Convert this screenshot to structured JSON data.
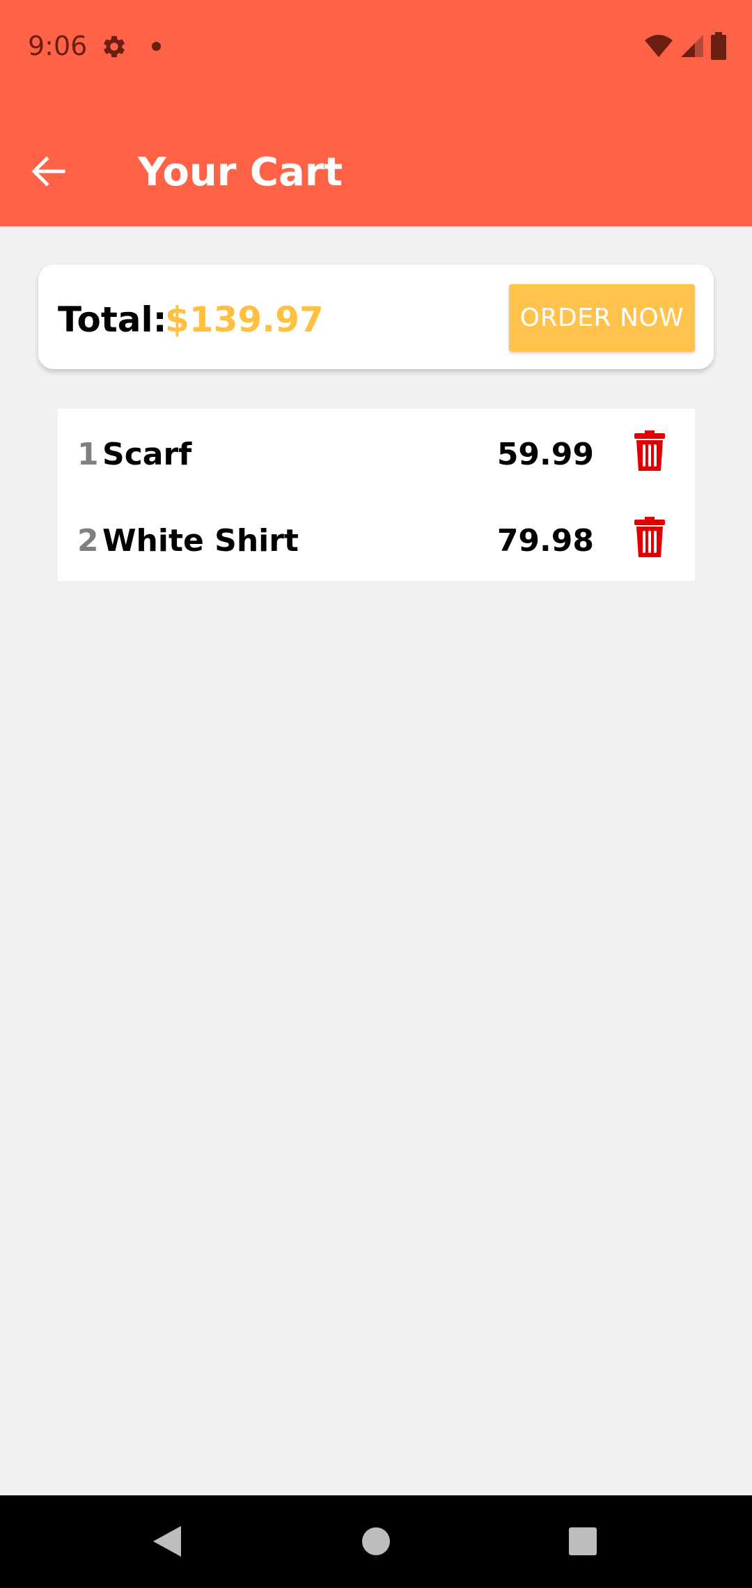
{
  "status_bar": {
    "time": "9:06",
    "icons": [
      "gear-icon",
      "notification-dot-icon",
      "wifi-icon",
      "cell-signal-icon",
      "battery-icon"
    ]
  },
  "app_bar": {
    "title": "Your Cart",
    "back_icon": "arrow-left-icon",
    "background_color": "#ff6347"
  },
  "summary": {
    "total_label": "Total:",
    "total_amount": "$139.97",
    "amount_color": "#ffbf40",
    "order_button_label": "ORDER NOW",
    "order_button_color": "#ffc24d"
  },
  "cart": {
    "items": [
      {
        "index": "1",
        "name": "Scarf",
        "price": "59.99",
        "delete_icon": "trash-icon"
      },
      {
        "index": "2",
        "name": "White Shirt",
        "price": "79.98",
        "delete_icon": "trash-icon"
      }
    ],
    "delete_color": "#e00000"
  },
  "nav_bar": {
    "buttons": [
      "back-triangle-icon",
      "home-circle-icon",
      "recents-square-icon"
    ]
  }
}
